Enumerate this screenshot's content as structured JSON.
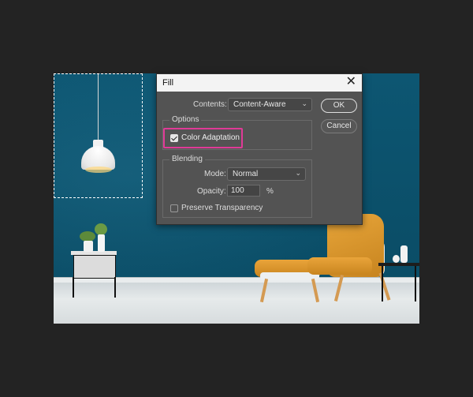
{
  "dialog": {
    "title": "Fill",
    "close_label": "✕",
    "contents_label": "Contents:",
    "contents_value": "Content-Aware",
    "options_group": "Options",
    "color_adaptation_label": "Color Adaptation",
    "color_adaptation_checked": true,
    "blending_group": "Blending",
    "mode_label": "Mode:",
    "mode_value": "Normal",
    "opacity_label": "Opacity:",
    "opacity_value": "100",
    "opacity_unit": "%",
    "preserve_label": "Preserve Transparency",
    "preserve_checked": false,
    "ok_label": "OK",
    "cancel_label": "Cancel",
    "dropdown_glyph": "⌄"
  },
  "colors": {
    "app_bg": "#232323",
    "dialog_bg": "#535353",
    "highlight": "#e03a97",
    "wall": "#0b4f69"
  }
}
